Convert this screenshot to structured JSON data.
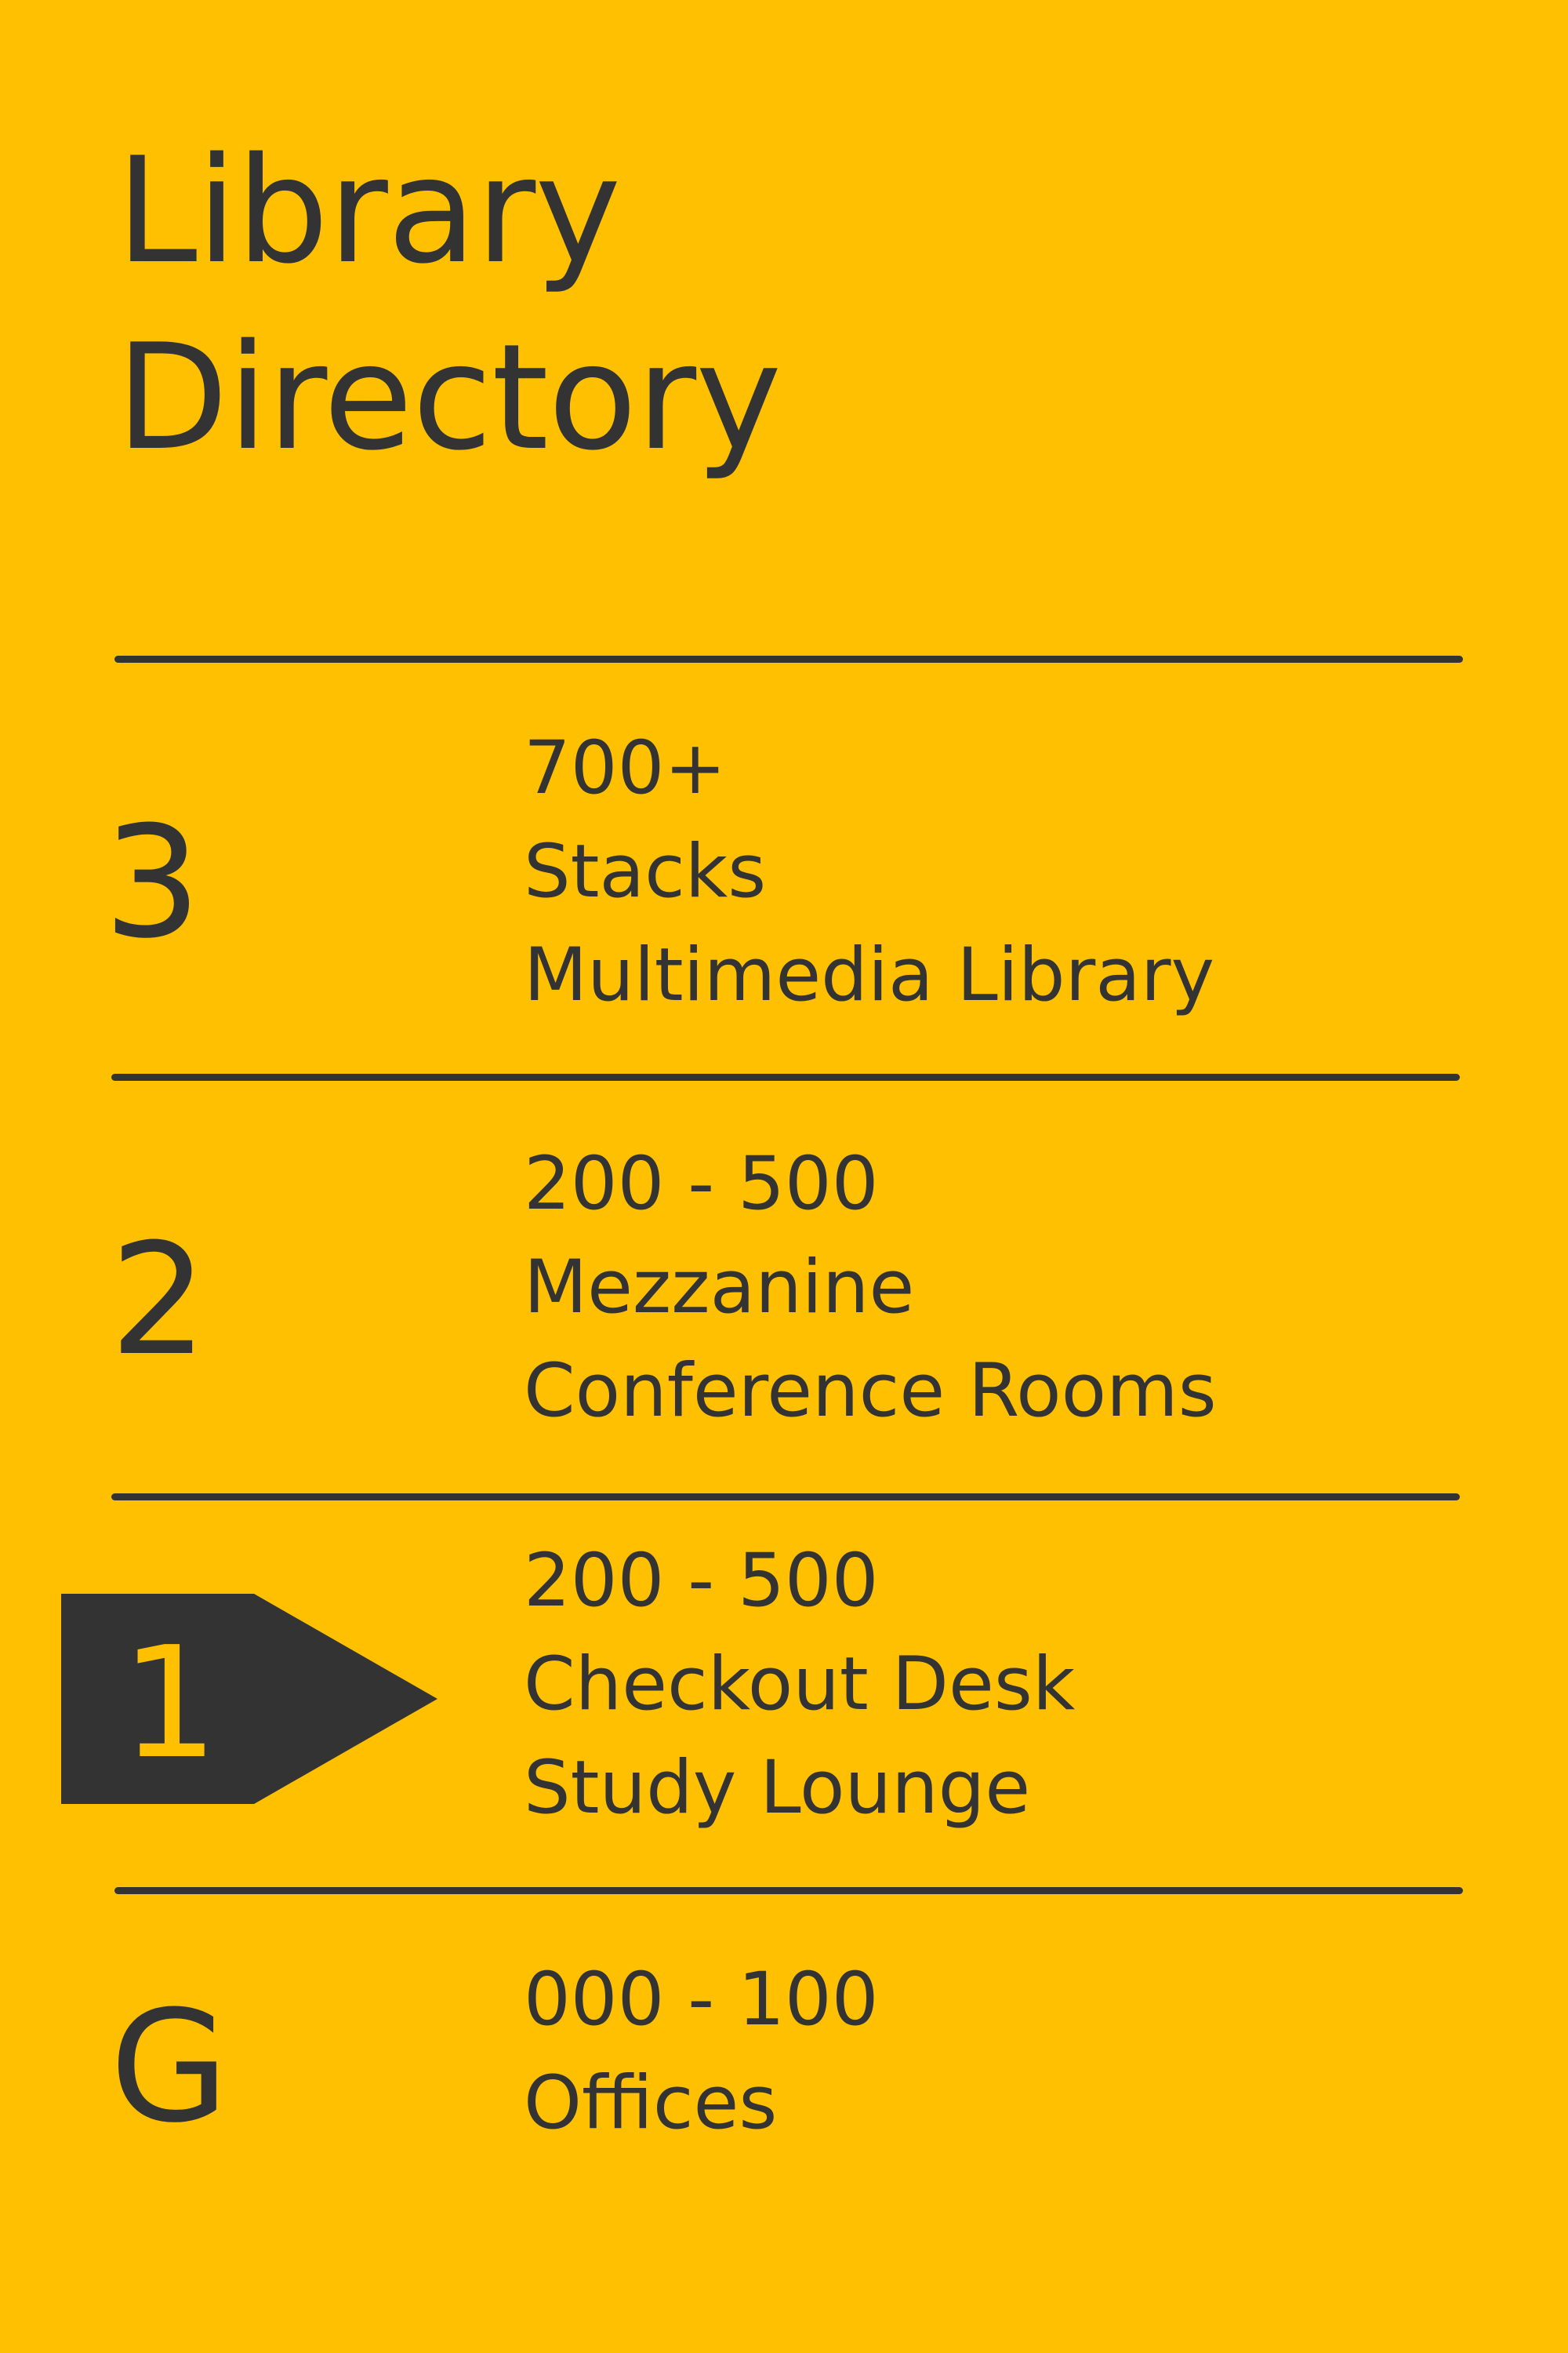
{
  "sign": {
    "title_line_1": "Library",
    "title_line_2": "Directory",
    "colors": {
      "background": "#fec000",
      "text": "#333333"
    },
    "floors": [
      {
        "number": "3",
        "lines": [
          "700+",
          "Stacks",
          "Multimedia Library"
        ]
      },
      {
        "number": "2",
        "lines": [
          "200 - 500",
          "Mezzanine",
          "Conference Rooms"
        ]
      },
      {
        "number": "1",
        "lines": [
          "200 - 500",
          "Checkout Desk",
          "Study Lounge"
        ],
        "current": true,
        "marker_icon": "you-are-here-arrow-icon"
      },
      {
        "number": "G",
        "lines": [
          "000 - 100",
          "Offices"
        ]
      }
    ]
  }
}
